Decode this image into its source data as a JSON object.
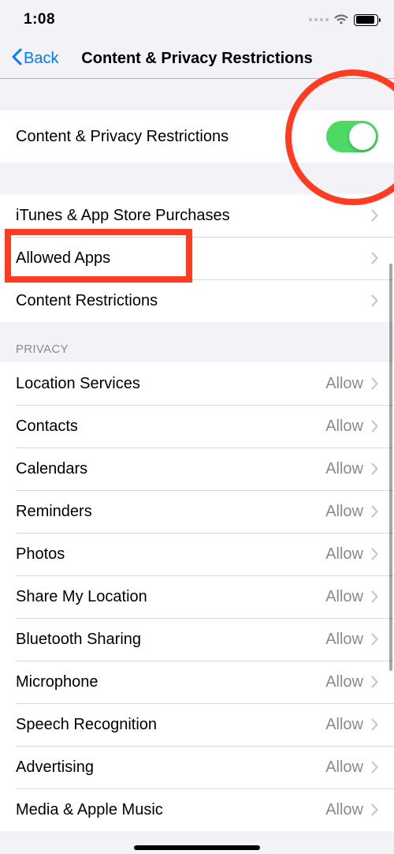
{
  "status": {
    "time": "1:08"
  },
  "nav": {
    "back": "Back",
    "title": "Content & Privacy Restrictions"
  },
  "toggleRow": {
    "label": "Content & Privacy Restrictions",
    "on": true
  },
  "group2": [
    {
      "key": "itunes",
      "label": "iTunes & App Store Purchases"
    },
    {
      "key": "allowed",
      "label": "Allowed Apps"
    },
    {
      "key": "content",
      "label": "Content Restrictions"
    }
  ],
  "privacy": {
    "header": "PRIVACY",
    "allowText": "Allow",
    "items": [
      {
        "key": "location",
        "label": "Location Services"
      },
      {
        "key": "contacts",
        "label": "Contacts"
      },
      {
        "key": "calendars",
        "label": "Calendars"
      },
      {
        "key": "reminders",
        "label": "Reminders"
      },
      {
        "key": "photos",
        "label": "Photos"
      },
      {
        "key": "share-loc",
        "label": "Share My Location"
      },
      {
        "key": "bluetooth",
        "label": "Bluetooth Sharing"
      },
      {
        "key": "microphone",
        "label": "Microphone"
      },
      {
        "key": "speech",
        "label": "Speech Recognition"
      },
      {
        "key": "advertising",
        "label": "Advertising"
      },
      {
        "key": "media-music",
        "label": "Media & Apple Music"
      }
    ]
  }
}
